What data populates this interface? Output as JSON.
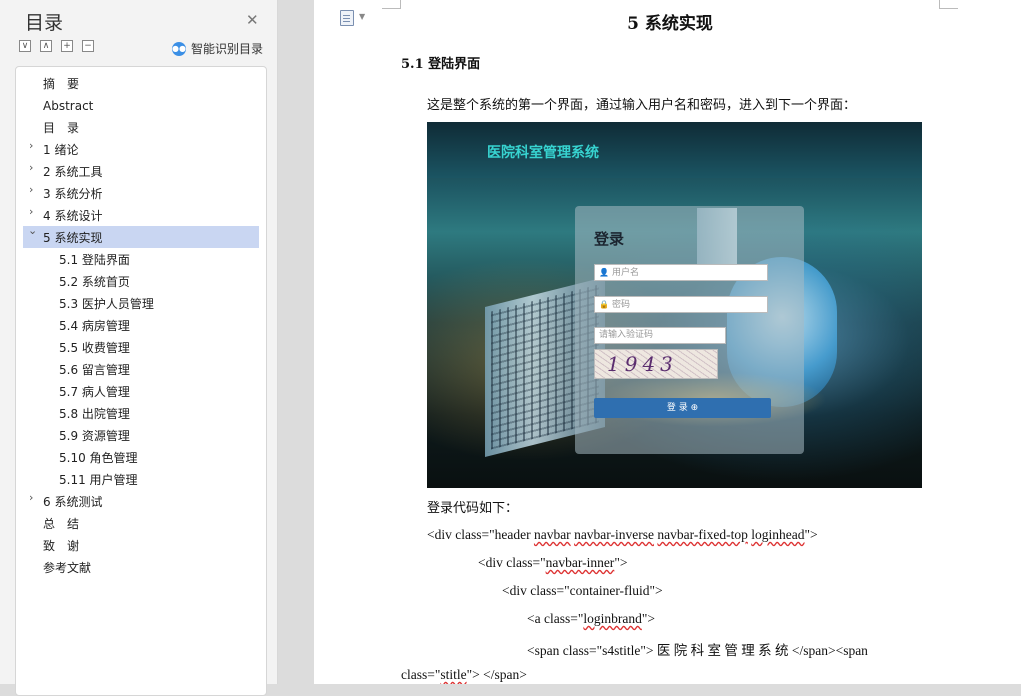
{
  "sidebar": {
    "title": "目录",
    "close_icon": "✕",
    "tools": [
      "∨",
      "∧",
      "+",
      "−"
    ],
    "smart_label": "智能识别目录",
    "toc": [
      {
        "label": "摘　要"
      },
      {
        "label": "Abstract"
      },
      {
        "label": "目　录"
      },
      {
        "label": "1 绪论"
      },
      {
        "label": "2 系统工具"
      },
      {
        "label": "3 系统分析"
      },
      {
        "label": "4 系统设计"
      },
      {
        "label": "5 系统实现"
      },
      {
        "label": "5.1 登陆界面"
      },
      {
        "label": "5.2  系统首页"
      },
      {
        "label": "5.3  医护人员管理"
      },
      {
        "label": "5.4  病房管理"
      },
      {
        "label": "5.5  收费管理"
      },
      {
        "label": "5.6  留言管理"
      },
      {
        "label": "5.7  病人管理"
      },
      {
        "label": "5.8  出院管理"
      },
      {
        "label": "5.9  资源管理"
      },
      {
        "label": "5.10  角色管理"
      },
      {
        "label": "5.11  用户管理"
      },
      {
        "label": "6 系统测试"
      },
      {
        "label": "总　结"
      },
      {
        "label": "致　谢"
      },
      {
        "label": "参考文献"
      }
    ],
    "chevron_right": "›",
    "chevron_down": "⌄"
  },
  "document": {
    "heading1": "5 系统实现",
    "heading2": "5.1 登陆界面",
    "para1": "这是整个系统的第一个界面，通过输入用户名和密码，进入到下一个界面：",
    "para2": "登录代码如下：",
    "figure": {
      "app_title": "医院科室管理系统",
      "login_title": "登录",
      "username_placeholder": "用户名",
      "password_placeholder": "密码",
      "captcha_placeholder": "请输入验证码",
      "captcha_text": "1943",
      "login_button": "登 录 ⊕"
    },
    "code": {
      "l1_a": "<div class=\"header ",
      "l1_b": "navbar",
      "l1_c": " ",
      "l1_d": "navbar-inverse",
      "l1_e": " ",
      "l1_f": "navbar-fixed-top",
      "l1_g": " ",
      "l1_h": "loginhead",
      "l1_i": "\">",
      "l2_a": "<div class=\"",
      "l2_b": "navbar-inner",
      "l2_c": "\">",
      "l3": "<div class=\"container-fluid\">",
      "l4_a": "<a class=\"",
      "l4_b": "loginbrand",
      "l4_c": "\">",
      "l5": "<span  class=\"s4stitle\">  医  院  科  室  管  理  系  统  </span><span",
      "l6_a": "class=\"",
      "l6_b": "stitle",
      "l6_c": "\"> </span>"
    }
  }
}
